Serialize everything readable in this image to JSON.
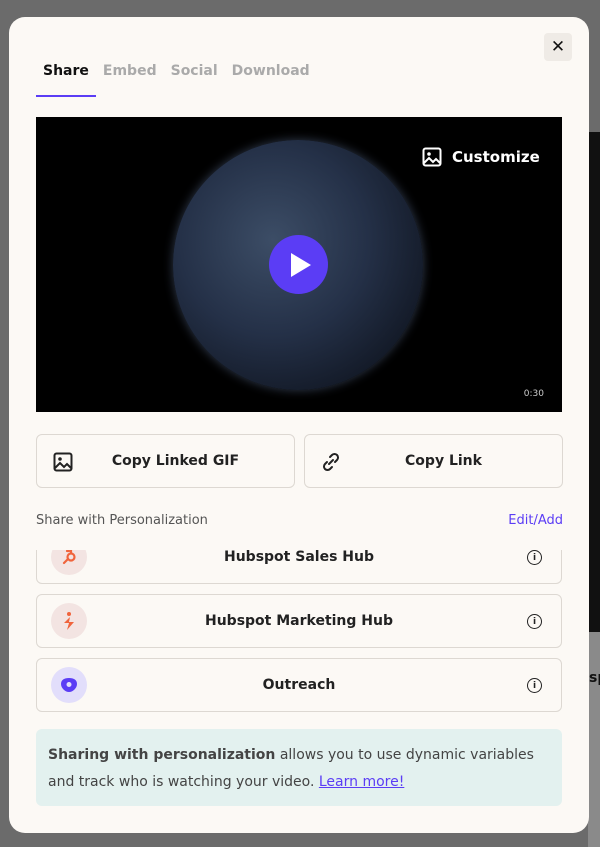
{
  "background": {
    "partial_text": "sp"
  },
  "modal": {
    "close_label": "✕",
    "tabs": [
      {
        "label": "Share",
        "active": true
      },
      {
        "label": "Embed",
        "active": false
      },
      {
        "label": "Social",
        "active": false
      },
      {
        "label": "Download",
        "active": false
      }
    ],
    "video": {
      "customize_label": "Customize",
      "duration": "0:30"
    },
    "actions": {
      "copy_gif": "Copy Linked GIF",
      "copy_link": "Copy Link"
    },
    "personalization": {
      "title": "Share with Personalization",
      "edit_label": "Edit/Add",
      "integrations": [
        {
          "label": "Hubspot Sales Hub",
          "icon": "hubspot-icon"
        },
        {
          "label": "Hubspot Marketing Hub",
          "icon": "lightning-icon"
        },
        {
          "label": "Outreach",
          "icon": "outreach-icon"
        }
      ]
    },
    "note": {
      "bold": "Sharing with personalization",
      "text": " allows you to use dynamic variables and track who is watching your video. ",
      "link": "Learn more!"
    }
  },
  "colors": {
    "accent": "#5b3df5",
    "note_bg": "#e3f1ef",
    "hubspot": "#f0643c"
  }
}
